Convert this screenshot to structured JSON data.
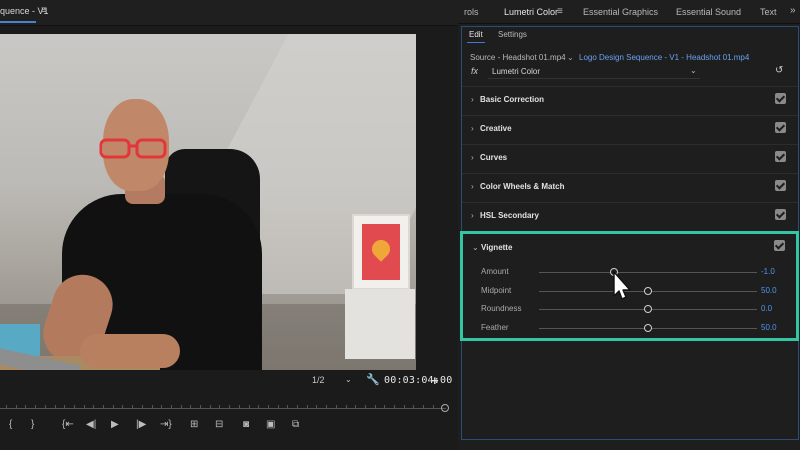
{
  "monitor": {
    "tab_title": "quence - V1",
    "zoom": "1/2",
    "timecode": "00:03:04:00",
    "transport": [
      {
        "icon": "mark-in-icon",
        "glyph": "{"
      },
      {
        "icon": "mark-out-icon",
        "glyph": "}"
      },
      {
        "icon": "go-to-in-icon",
        "glyph": "{⇤"
      },
      {
        "icon": "step-back-icon",
        "glyph": "◀|"
      },
      {
        "icon": "play-icon",
        "glyph": "▶"
      },
      {
        "icon": "step-forward-icon",
        "glyph": "|▶"
      },
      {
        "icon": "go-to-out-icon",
        "glyph": "⇥}"
      },
      {
        "icon": "lift-icon",
        "glyph": "⊞"
      },
      {
        "icon": "extract-icon",
        "glyph": "⊟"
      },
      {
        "icon": "export-frame-icon",
        "glyph": "◙"
      },
      {
        "icon": "insert-icon",
        "glyph": "▣"
      },
      {
        "icon": "overwrite-icon",
        "glyph": "⧉"
      }
    ],
    "add_button": "+"
  },
  "panel": {
    "tabs": [
      "rols",
      "Lumetri Color",
      "Essential Graphics",
      "Essential Sound",
      "Text"
    ],
    "more": "»",
    "subtabs": [
      "Edit",
      "Settings"
    ],
    "source_label": "Source - Headshot 01.mp4",
    "sequence_link": "Logo Design Sequence - V1 - Headshot 01.mp4",
    "fx_label": "fx",
    "effect": "Lumetri Color",
    "sections": [
      {
        "title": "Basic Correction",
        "enabled": true
      },
      {
        "title": "Creative",
        "enabled": true
      },
      {
        "title": "Curves",
        "enabled": true
      },
      {
        "title": "Color Wheels & Match",
        "enabled": true
      },
      {
        "title": "HSL Secondary",
        "enabled": true
      }
    ],
    "vignette": {
      "title": "Vignette",
      "enabled": true,
      "sliders": [
        {
          "label": "Amount",
          "value": "-1.0",
          "fraction": 0.345
        },
        {
          "label": "Midpoint",
          "value": "50.0",
          "fraction": 0.5
        },
        {
          "label": "Roundness",
          "value": "0.0",
          "fraction": 0.5
        },
        {
          "label": "Feather",
          "value": "50.0",
          "fraction": 0.5
        }
      ]
    },
    "highlight_color": "#33c6a5",
    "link_color": "#4d96f0"
  }
}
